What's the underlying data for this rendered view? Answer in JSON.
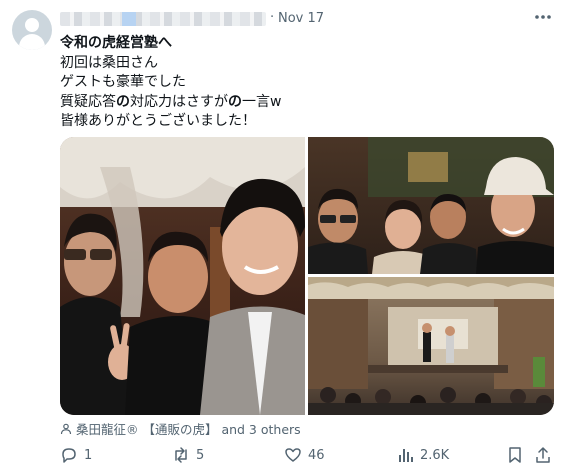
{
  "post": {
    "date_separator": "·",
    "date": "Nov 17",
    "text": {
      "line1": "令和の虎経営塾へ",
      "line2": "初回は桑田さん",
      "line3": "ゲストも豪華でした",
      "line4_a": "質疑応答",
      "line4_b": "の",
      "line4_c": "対応力はさすが",
      "line4_d": "の",
      "line4_e": "一言w",
      "line5": "皆様ありがとうございました！"
    },
    "tagged": "桑田龍征® 【通販の虎】 and 3 others"
  },
  "actions": {
    "replies": "1",
    "reposts": "5",
    "likes": "46",
    "views": "2.6K"
  },
  "colors": {
    "text": "#0f1419",
    "secondary": "#536471"
  },
  "icons": [
    "more-icon",
    "tag-person-icon",
    "reply-icon",
    "repost-icon",
    "like-icon",
    "views-icon",
    "bookmark-icon",
    "share-icon"
  ]
}
